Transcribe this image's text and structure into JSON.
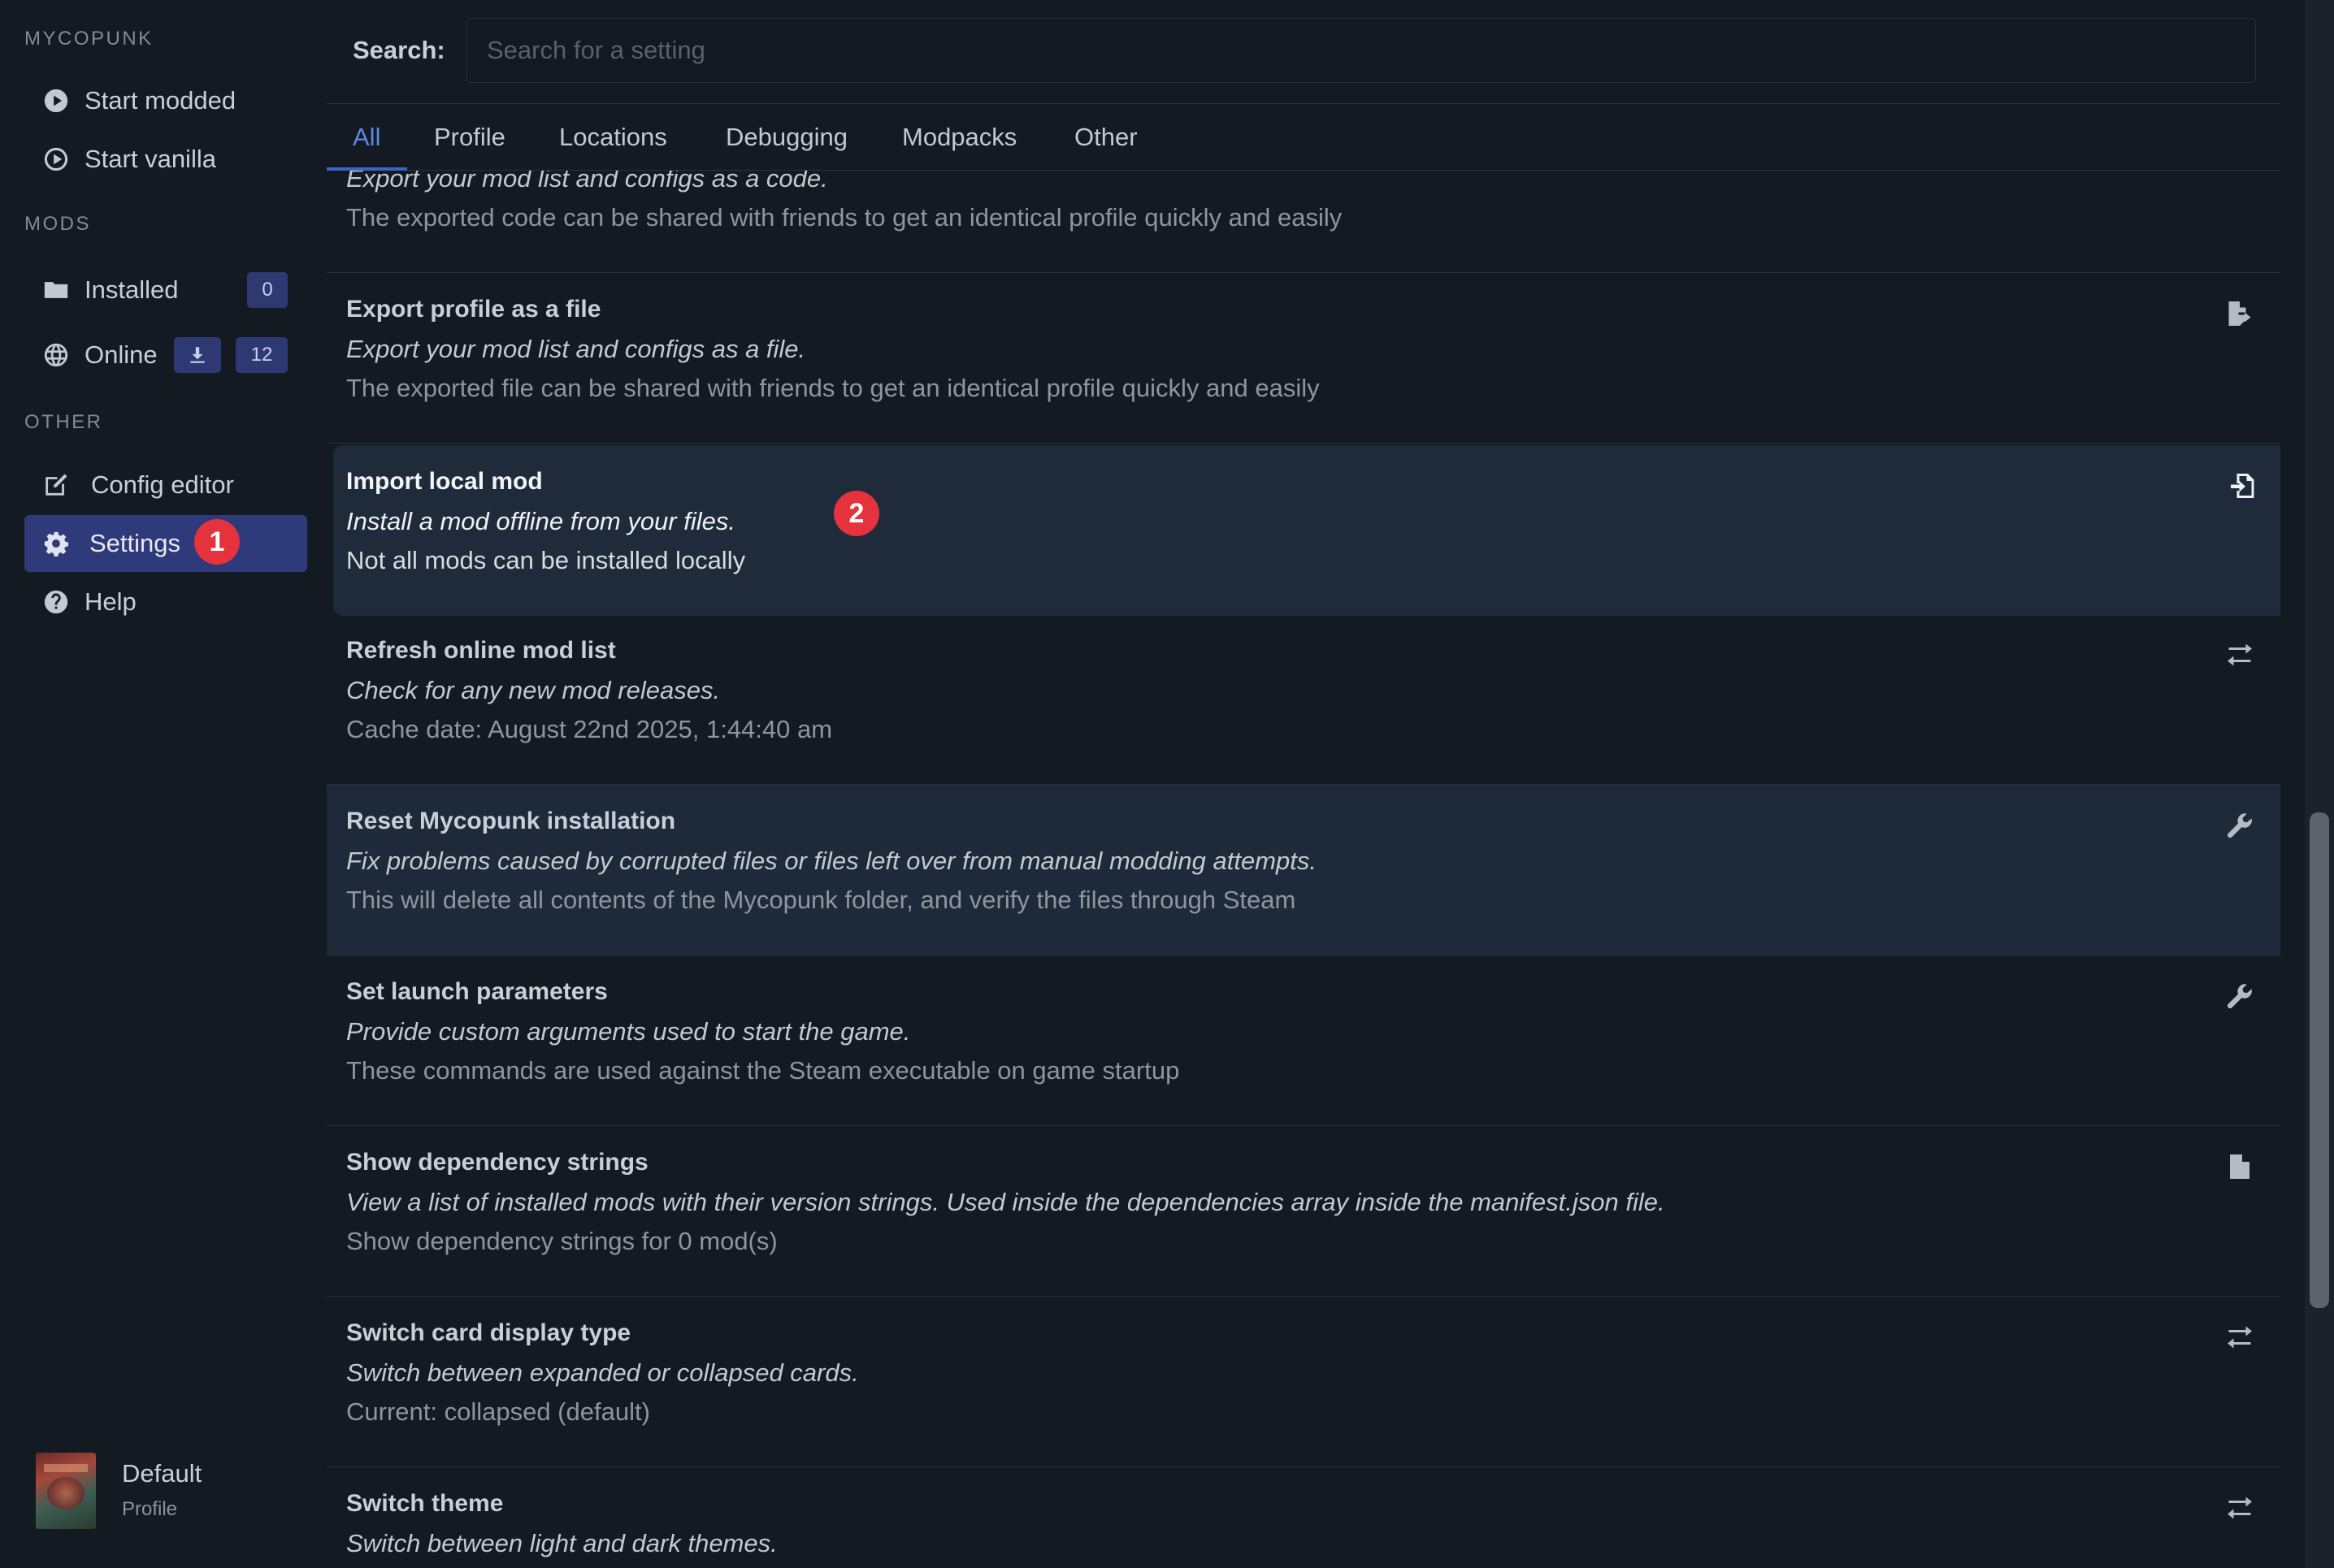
{
  "sidebar": {
    "sections": {
      "game": "MYCOPUNK",
      "mods": "MODS",
      "other": "OTHER"
    },
    "items": {
      "start_modded": "Start modded",
      "start_vanilla": "Start vanilla",
      "installed": "Installed",
      "installed_count": "0",
      "online": "Online",
      "online_count": "12",
      "config_editor": "Config editor",
      "settings": "Settings",
      "help": "Help"
    },
    "profile": {
      "name": "Default",
      "label": "Profile"
    }
  },
  "markers": {
    "one": "1",
    "two": "2"
  },
  "search": {
    "label": "Search:",
    "placeholder": "Search for a setting",
    "value": ""
  },
  "tabs": [
    {
      "label": "All",
      "active": true
    },
    {
      "label": "Profile"
    },
    {
      "label": "Locations"
    },
    {
      "label": "Debugging"
    },
    {
      "label": "Modpacks"
    },
    {
      "label": "Other"
    }
  ],
  "settings": [
    {
      "title": "",
      "description": "Export your mod list and configs as a code.",
      "info": "The exported code can be shared with friends to get an identical profile quickly and easily",
      "icon": "none"
    },
    {
      "title": "Export profile as a file",
      "description": "Export your mod list and configs as a file.",
      "info": "The exported file can be shared with friends to get an identical profile quickly and easily",
      "icon": "file-export-icon"
    },
    {
      "title": "Import local mod",
      "description": "Install a mod offline from your files.",
      "info": "Not all mods can be installed locally",
      "icon": "file-import-icon"
    },
    {
      "title": "Refresh online mod list",
      "description": "Check for any new mod releases.",
      "info": "Cache date: August 22nd 2025, 1:44:40 am",
      "icon": "exchange-icon"
    },
    {
      "title": "Reset Mycopunk installation",
      "description": "Fix problems caused by corrupted files or files left over from manual modding attempts.",
      "info": "This will delete all contents of the Mycopunk folder, and verify the files through Steam",
      "icon": "wrench-icon"
    },
    {
      "title": "Set launch parameters",
      "description": "Provide custom arguments used to start the game.",
      "info": "These commands are used against the Steam executable on game startup",
      "icon": "wrench-icon"
    },
    {
      "title": "Show dependency strings",
      "description": "View a list of installed mods with their version strings. Used inside the dependencies array inside the manifest.json file.",
      "info": "Show dependency strings for 0 mod(s)",
      "icon": "file-text-icon"
    },
    {
      "title": "Switch card display type",
      "description": "Switch between expanded or collapsed cards.",
      "info": "Current: collapsed (default)",
      "icon": "exchange-icon"
    },
    {
      "title": "Switch theme",
      "description": "Switch between light and dark themes.",
      "info": "",
      "icon": "exchange-icon"
    }
  ],
  "colors": {
    "background": "#141a22",
    "accent": "#3c63c9",
    "active_nav": "#2f3a7a",
    "marker": "#e5333d"
  }
}
